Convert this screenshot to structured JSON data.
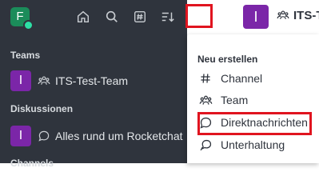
{
  "workspace": {
    "avatar_letter": "F",
    "status_color": "#2de0a5"
  },
  "toolbar": {
    "icons": [
      "home-icon",
      "search-icon",
      "directory-icon",
      "sort-icon",
      "create-new-icon"
    ]
  },
  "sidebar": {
    "sections": [
      {
        "title": "Teams",
        "items": [
          {
            "avatar_letter": "I",
            "icon": "team-icon",
            "label": "ITS-Test-Team"
          }
        ]
      },
      {
        "title": "Diskussionen",
        "items": [
          {
            "avatar_letter": "I",
            "icon": "discussion-icon",
            "label": "Alles rund um Rocketchat"
          }
        ]
      },
      {
        "title": "Channels",
        "items": []
      }
    ]
  },
  "header": {
    "avatar_letter": "I",
    "room_icon": "team-icon",
    "title": "ITS-T"
  },
  "create_menu": {
    "heading": "Neu erstellen",
    "items": [
      {
        "icon": "hash-icon",
        "label": "Channel"
      },
      {
        "icon": "team-icon",
        "label": "Team"
      },
      {
        "icon": "direct-message-icon",
        "label": "Direktnachrichten"
      },
      {
        "icon": "discussion-icon",
        "label": "Unterhaltung"
      }
    ]
  },
  "colors": {
    "sidebar_bg": "#2f343d",
    "room_avatar": "#7b26a8",
    "highlight": "#e0141f",
    "workspace_avatar": "#1b8c5a"
  }
}
